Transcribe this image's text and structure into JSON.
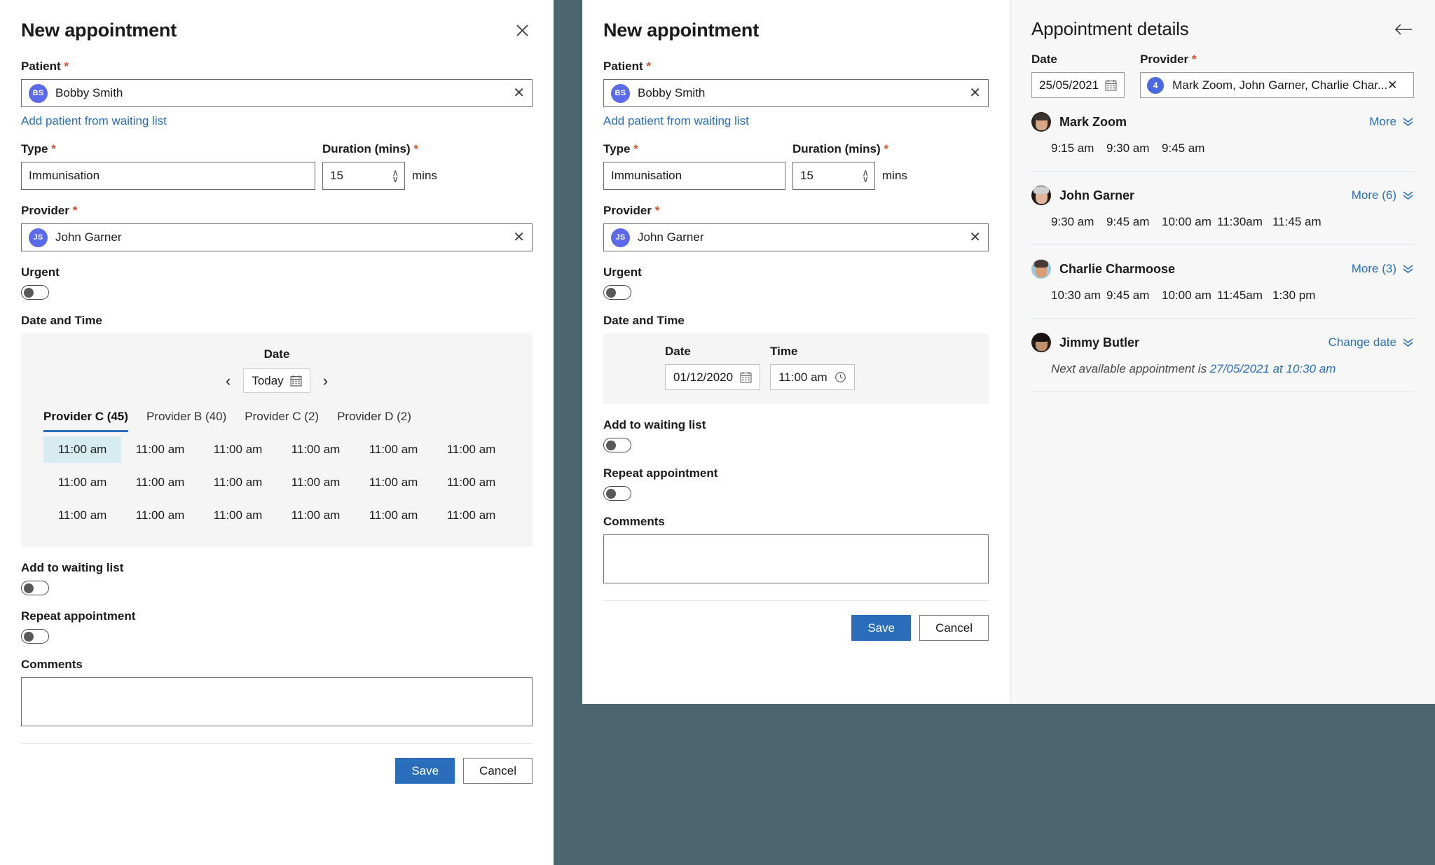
{
  "background_color": "#4c6670",
  "accent_color": "#2a6ebb",
  "required_color": "#d0512b",
  "selected_slot_color": "#d7ecf1",
  "left_panel": {
    "title": "New appointment",
    "close_icon": "close-icon",
    "patient": {
      "label": "Patient",
      "required_mark": "*",
      "value": "Bobby Smith",
      "initials": "BS",
      "clear_icon": "close-icon",
      "waiting_list_link": "Add patient from waiting list"
    },
    "type": {
      "label": "Type",
      "required_mark": "*",
      "value": "Immunisation"
    },
    "duration": {
      "label": "Duration (mins)",
      "required_mark": "*",
      "value": "15",
      "unit": "mins"
    },
    "provider": {
      "label": "Provider",
      "required_mark": "*",
      "value": "John Garner",
      "initials": "JS",
      "clear_icon": "close-icon"
    },
    "urgent": {
      "label": "Urgent",
      "state": "off"
    },
    "date_and_time": {
      "section_label": "Date and Time",
      "date_label": "Date",
      "today_button": "Today",
      "calendar_icon": "calendar-icon",
      "prev_icon": "chevron-left-icon",
      "next_icon": "chevron-right-icon",
      "tabs": [
        {
          "label": "Provider C (45)",
          "active": true
        },
        {
          "label": "Provider B (40)",
          "active": false
        },
        {
          "label": "Provider C (2)",
          "active": false
        },
        {
          "label": "Provider D (2)",
          "active": false
        }
      ],
      "slots": [
        "11:00 am",
        "11:00 am",
        "11:00 am",
        "11:00 am",
        "11:00 am",
        "11:00 am",
        "11:00 am",
        "11:00 am",
        "11:00 am",
        "11:00 am",
        "11:00 am",
        "11:00 am",
        "11:00 am",
        "11:00 am",
        "11:00 am",
        "11:00 am",
        "11:00 am",
        "11:00 am"
      ],
      "selected_slot_index": 0
    },
    "waiting_list": {
      "label": "Add to waiting list",
      "state": "off"
    },
    "repeat": {
      "label": "Repeat appointment",
      "state": "off"
    },
    "comments": {
      "label": "Comments",
      "value": "",
      "placeholder": ""
    },
    "save_label": "Save",
    "cancel_label": "Cancel"
  },
  "mid_panel": {
    "title": "New appointment",
    "patient": {
      "label": "Patient",
      "required_mark": "*",
      "value": "Bobby Smith",
      "initials": "BS",
      "clear_icon": "close-icon",
      "waiting_list_link": "Add patient from waiting list"
    },
    "type": {
      "label": "Type",
      "required_mark": "*",
      "value": "Immunisation"
    },
    "duration": {
      "label": "Duration (mins)",
      "required_mark": "*",
      "value": "15",
      "unit": "mins"
    },
    "provider": {
      "label": "Provider",
      "required_mark": "*",
      "value": "John Garner",
      "initials": "JS",
      "clear_icon": "close-icon"
    },
    "urgent": {
      "label": "Urgent",
      "state": "off"
    },
    "date_and_time": {
      "section_label": "Date and Time",
      "date_label": "Date",
      "date_value": "01/12/2020",
      "calendar_icon": "calendar-icon",
      "time_label": "Time",
      "time_value": "11:00 am",
      "clock_icon": "clock-icon"
    },
    "waiting_list": {
      "label": "Add to waiting list",
      "state": "off"
    },
    "repeat": {
      "label": "Repeat appointment",
      "state": "off"
    },
    "comments": {
      "label": "Comments",
      "value": "",
      "placeholder": ""
    },
    "save_label": "Save",
    "cancel_label": "Cancel"
  },
  "right_panel": {
    "title": "Appointment details",
    "back_icon": "arrow-left-icon",
    "date": {
      "label": "Date",
      "value": "25/05/2021",
      "calendar_icon": "calendar-icon"
    },
    "provider": {
      "label": "Provider",
      "required_mark": "*",
      "count": "4",
      "value": "Mark Zoom, John Garner, Charlie Char...",
      "clear_icon": "close-icon"
    },
    "providers": [
      {
        "name": "Mark Zoom",
        "avatar": "avatar-mark-zoom",
        "action_label": "More",
        "expand_icon": "chevron-double-down-icon",
        "times": [
          "9:15 am",
          "9:30 am",
          "9:45 am"
        ],
        "note": ""
      },
      {
        "name": "John Garner",
        "avatar": "avatar-john-garner",
        "action_label": "More (6)",
        "expand_icon": "chevron-double-down-icon",
        "times": [
          "9:30 am",
          "9:45 am",
          "10:00 am",
          "11:30am",
          "11:45 am"
        ],
        "note": ""
      },
      {
        "name": "Charlie Charmoose",
        "avatar": "avatar-charlie-charmoose",
        "action_label": "More (3)",
        "expand_icon": "chevron-double-down-icon",
        "times": [
          "10:30 am",
          "9:45 am",
          "10:00 am",
          "11:45am",
          "1:30 pm"
        ],
        "note": ""
      },
      {
        "name": "Jimmy Butler",
        "avatar": "avatar-jimmy-butler",
        "action_label": "Change date",
        "expand_icon": "chevron-double-down-icon",
        "times": [],
        "note_prefix": "Next available appointment is ",
        "note_highlight": "27/05/2021 at 10:30 am"
      }
    ]
  }
}
